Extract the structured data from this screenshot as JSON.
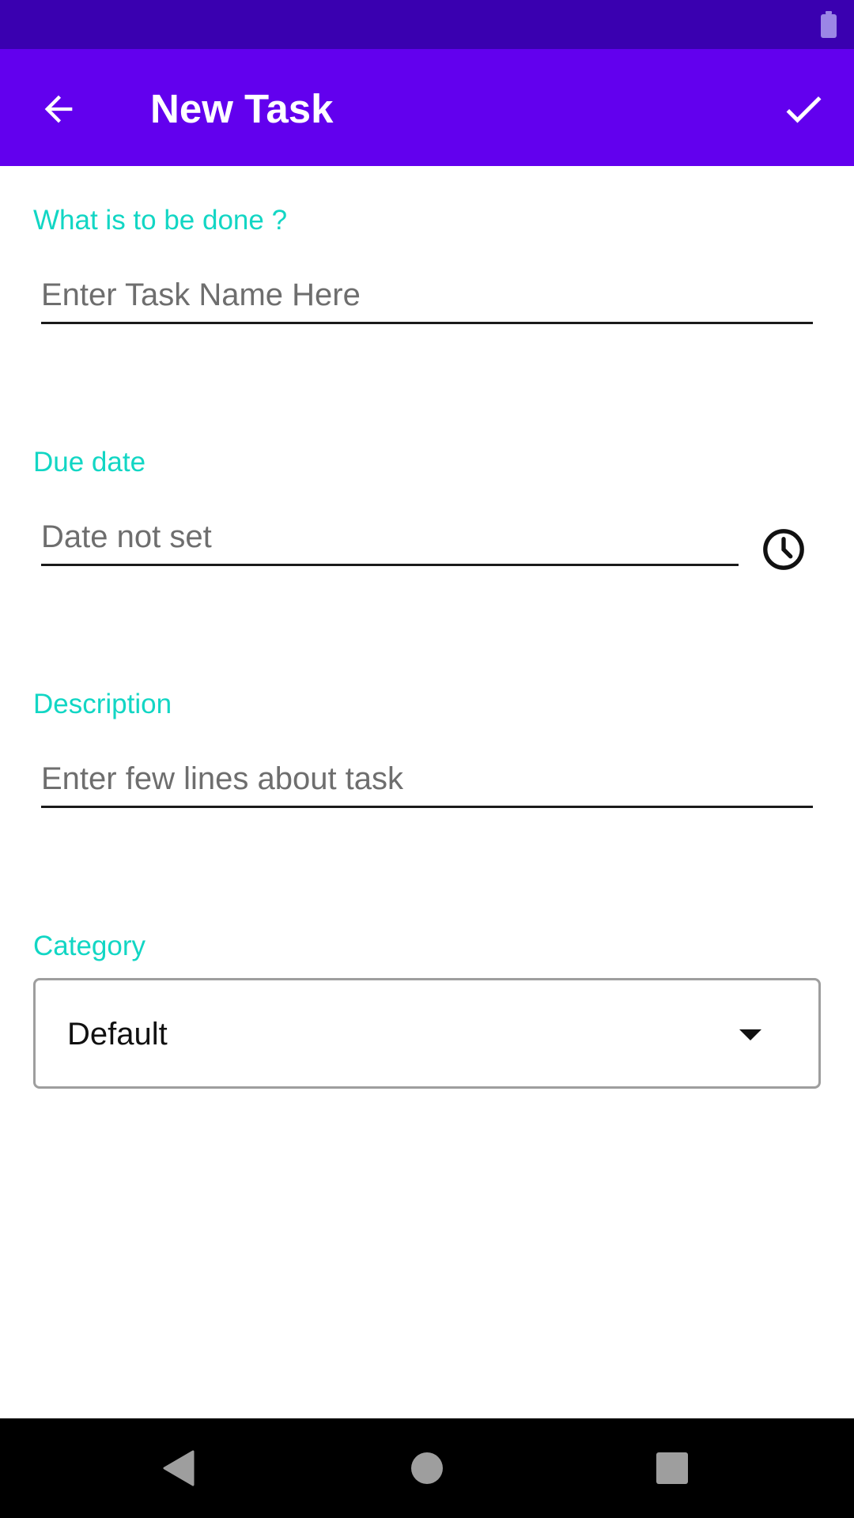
{
  "app_bar": {
    "title": "New Task",
    "back_icon": "arrow-back-icon",
    "confirm_icon": "checkmark-icon",
    "color": "#6200ee"
  },
  "status_bar": {
    "color": "#3a00b0",
    "battery_icon": "battery-icon"
  },
  "form": {
    "task_name": {
      "label": "What is to be done ?",
      "placeholder": "Enter Task Name Here",
      "value": ""
    },
    "due_date": {
      "label": "Due date",
      "placeholder": "Date not set",
      "value": "",
      "icon": "clock-icon"
    },
    "description": {
      "label": "Description",
      "placeholder": "Enter few lines about task",
      "value": ""
    },
    "category": {
      "label": "Category",
      "selected": "Default",
      "icon": "dropdown-arrow-icon"
    },
    "label_color": "#12d6c4"
  },
  "nav_bar": {
    "back_icon": "nav-back-icon",
    "home_icon": "nav-home-icon",
    "recents_icon": "nav-recents-icon"
  }
}
